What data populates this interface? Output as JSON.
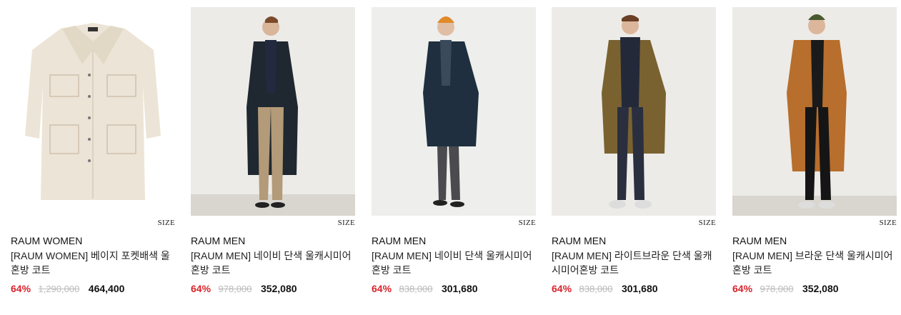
{
  "products": [
    {
      "size_label": "SIZE",
      "brand": "RAUM WOMEN",
      "name": "[RAUM WOMEN] 베이지 포켓배색 울혼방 코트",
      "discount": "64%",
      "original_price": "1,290,000",
      "sale_price": "464,400",
      "image": "beige-coat-product-photo"
    },
    {
      "size_label": "SIZE",
      "brand": "RAUM MEN",
      "name": "[RAUM MEN] 네이비 단색 울캐시미어혼방 코트",
      "discount": "64%",
      "original_price": "978,000",
      "sale_price": "352,080",
      "image": "navy-coat-model-photo"
    },
    {
      "size_label": "SIZE",
      "brand": "RAUM MEN",
      "name": "[RAUM MEN] 네이비 단색 울캐시미어혼방 코트",
      "discount": "64%",
      "original_price": "838,000",
      "sale_price": "301,680",
      "image": "navy-short-coat-model-photo"
    },
    {
      "size_label": "SIZE",
      "brand": "RAUM MEN",
      "name": "[RAUM MEN] 라이트브라운 단색 울캐시미어혼방 코트",
      "discount": "64%",
      "original_price": "838,000",
      "sale_price": "301,680",
      "image": "light-brown-coat-model-photo"
    },
    {
      "size_label": "SIZE",
      "brand": "RAUM MEN",
      "name": "[RAUM MEN] 브라운 단색 울캐시미어혼방 코트",
      "discount": "64%",
      "original_price": "978,000",
      "sale_price": "352,080",
      "image": "brown-coat-model-photo"
    }
  ],
  "colors": {
    "discount": "#d8242c",
    "original_price": "#bbbbbb",
    "text": "#111111"
  }
}
